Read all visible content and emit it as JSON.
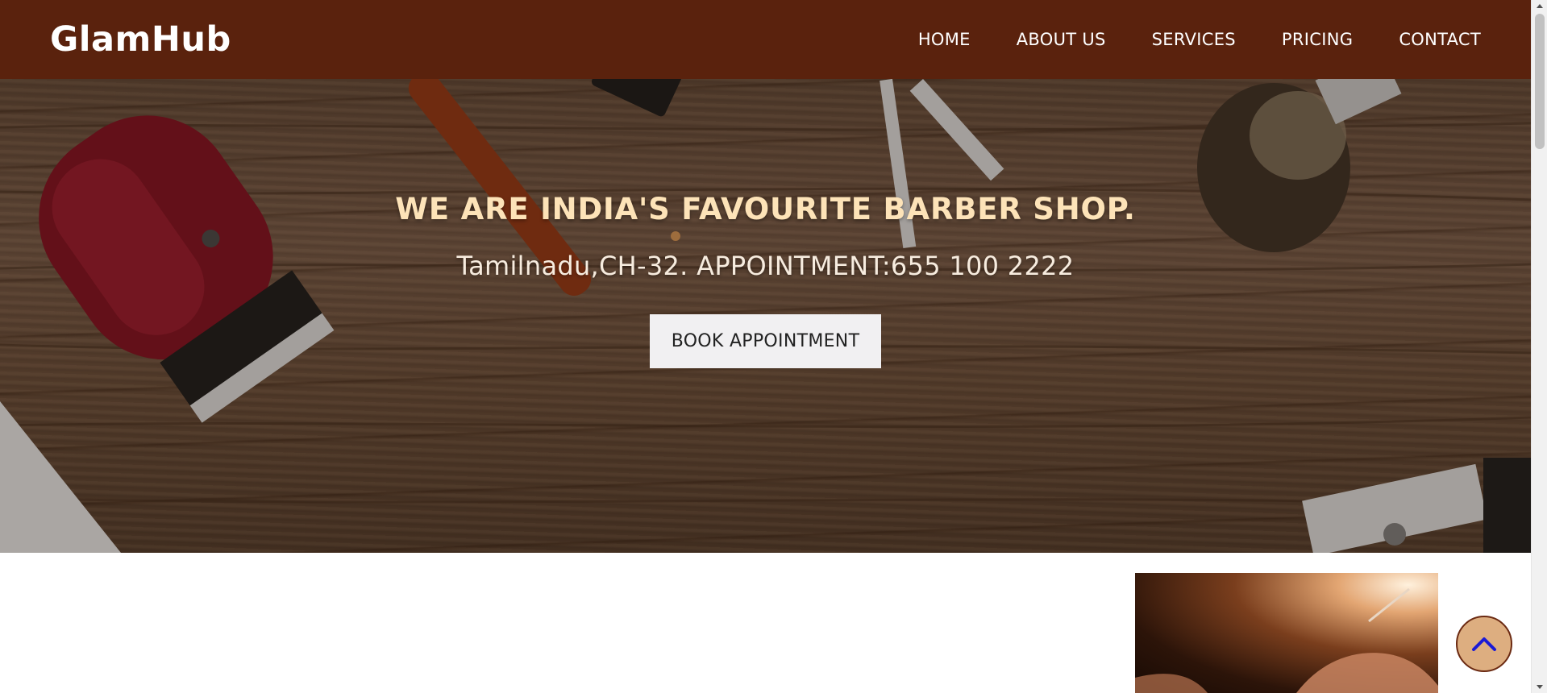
{
  "brand": "GlamHub",
  "nav": {
    "items": [
      "HOME",
      "ABOUT US",
      "SERVICES",
      "PRICING",
      "CONTACT"
    ]
  },
  "hero": {
    "title": "WE ARE INDIA'S FAVOURITE BARBER SHOP.",
    "subtitle": "Tamilnadu,CH-32. APPOINTMENT:655 100 2222",
    "button_label": "BOOK APPOINTMENT"
  },
  "colors": {
    "navbar_bg": "#5a220d",
    "hero_title": "#fde3b8",
    "button_bg": "#f1f0f2",
    "scroll_top_bg": "#ddae80",
    "scroll_top_arrow": "#1a1ad6"
  },
  "icons": {
    "scroll_top": "chevron-up-icon"
  }
}
